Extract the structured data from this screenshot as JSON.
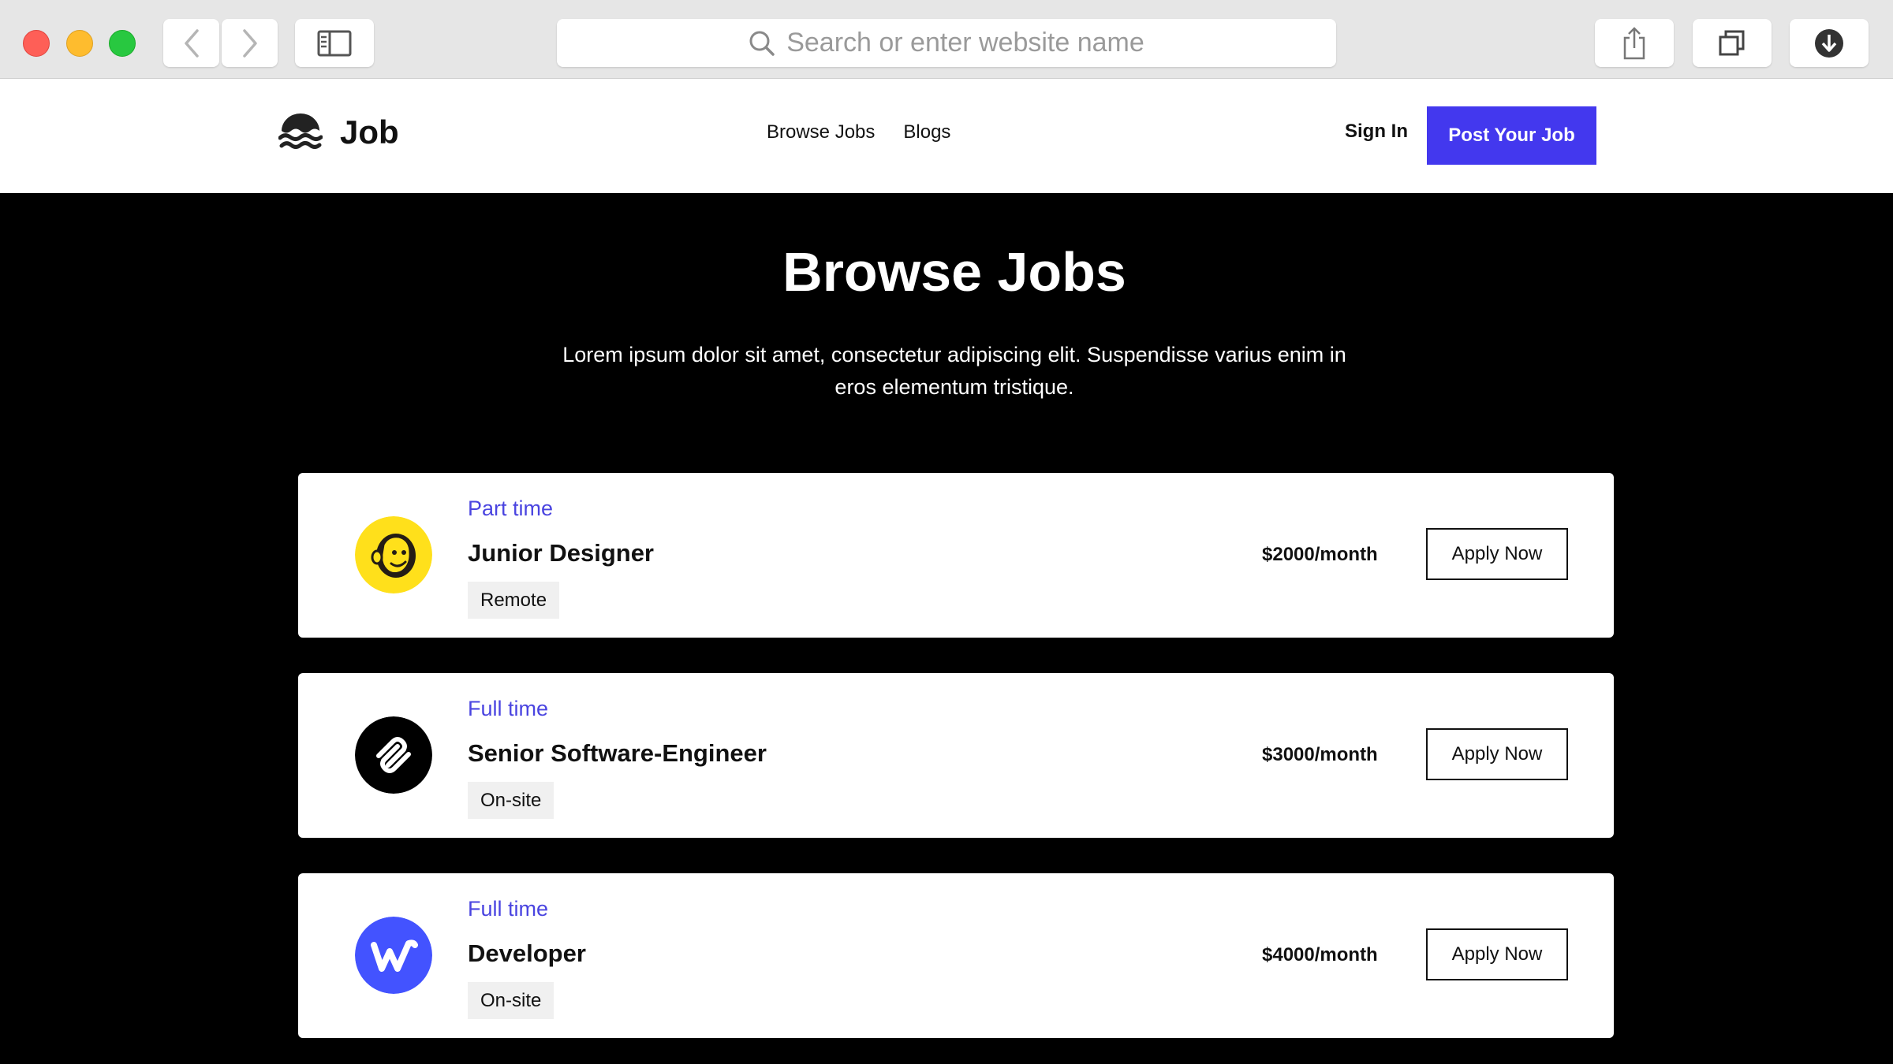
{
  "browser": {
    "url_placeholder": "Search or enter website name"
  },
  "header": {
    "brand": "Job",
    "nav": [
      "Browse Jobs",
      "Blogs"
    ],
    "sign_in": "Sign In",
    "post_job": "Post Your Job"
  },
  "hero": {
    "title": "Browse Jobs",
    "subtitle": "Lorem ipsum dolor sit amet, consectetur adipiscing elit. Suspendisse varius enim in eros elementum tristique."
  },
  "jobs": [
    {
      "type": "Part time",
      "title": "Junior Designer",
      "tag": "Remote",
      "salary": "$2000/month",
      "apply": "Apply Now",
      "logo": "mailchimp-logo"
    },
    {
      "type": "Full time",
      "title": "Senior Software-Engineer",
      "tag": "On-site",
      "salary": "$3000/month",
      "apply": "Apply Now",
      "logo": "squarespace-logo"
    },
    {
      "type": "Full time",
      "title": "Developer",
      "tag": "On-site",
      "salary": "$4000/month",
      "apply": "Apply Now",
      "logo": "webflow-logo"
    }
  ],
  "colors": {
    "accent": "#4338ee",
    "job_type": "#4a44e0",
    "hero_bg": "#000000",
    "mailchimp_yellow": "#ffe01b",
    "webflow_blue": "#4353ff"
  }
}
